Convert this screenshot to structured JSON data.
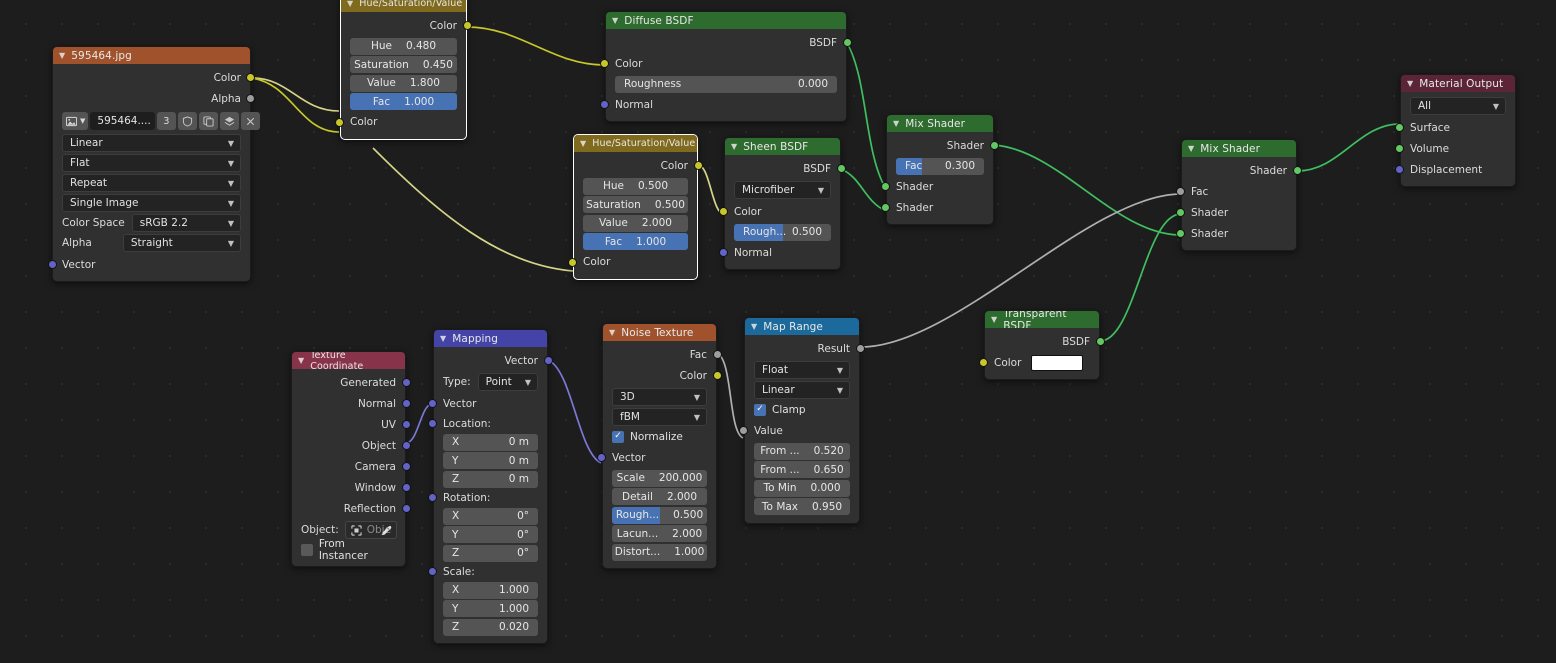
{
  "editor": {
    "name": "Blender Shader Node Editor",
    "background": "#1d1d1d"
  },
  "palette": {
    "input_header": "#a0522d",
    "color_header": "#806a1d",
    "shader_header": "#2e6b2e",
    "output_header": "#5b2537",
    "vector_header": "#4343a8",
    "texture_header": "#a0522d",
    "converter_header": "#1b6a9b",
    "slider_fill": "#4772b3",
    "socket_color": "#c7c729",
    "socket_shader": "#63c763",
    "socket_vector": "#6363c7",
    "socket_float": "#9d9d9d",
    "wire_color": "#d6d48a",
    "wire_shader": "#3fbf5f",
    "wire_float": "#b0b0b0",
    "wire_vector": "#7a79d4"
  },
  "nodes": {
    "image_texture": {
      "title": "595464.jpg",
      "outputs": [
        {
          "label": "Color"
        },
        {
          "label": "Alpha"
        }
      ],
      "toolbar": {
        "browse_icon": "image-browse-icon",
        "chevron_icon": "chevron-down-icon",
        "name": "595464....",
        "users": "3",
        "fake_user_icon": "shield-icon",
        "copy_icon": "duplicate-icon",
        "pack_icon": "pack-icon",
        "unlink_icon": "close-icon"
      },
      "interpolation": "Linear",
      "projection": "Flat",
      "extension": "Repeat",
      "source": "Single Image",
      "color_space_label": "Color Space",
      "color_space": "sRGB 2.2",
      "alpha_label": "Alpha",
      "alpha": "Straight",
      "inputs": [
        {
          "label": "Vector"
        }
      ]
    },
    "hsv_top": {
      "title": "Hue/Saturation/Value",
      "outputs": [
        {
          "label": "Color"
        }
      ],
      "fields": [
        {
          "name": "Hue",
          "value": "0.480"
        },
        {
          "name": "Saturation",
          "value": "0.450"
        },
        {
          "name": "Value",
          "value": "1.800"
        },
        {
          "name": "Fac",
          "value": "1.000"
        }
      ],
      "inputs": [
        {
          "label": "Color"
        }
      ]
    },
    "hsv_bottom": {
      "title": "Hue/Saturation/Value",
      "outputs": [
        {
          "label": "Color"
        }
      ],
      "fields": [
        {
          "name": "Hue",
          "value": "0.500"
        },
        {
          "name": "Saturation",
          "value": "0.500"
        },
        {
          "name": "Value",
          "value": "2.000"
        },
        {
          "name": "Fac",
          "value": "1.000"
        }
      ],
      "inputs": [
        {
          "label": "Color"
        }
      ]
    },
    "diffuse_bsdf": {
      "title": "Diffuse BSDF",
      "outputs": [
        {
          "label": "BSDF"
        }
      ],
      "color_label": "Color",
      "roughness": {
        "name": "Roughness",
        "value": "0.000"
      },
      "normal_label": "Normal"
    },
    "sheen_bsdf": {
      "title": "Sheen BSDF",
      "outputs": [
        {
          "label": "BSDF"
        }
      ],
      "distribution": "Microfiber",
      "color_label": "Color",
      "roughness": {
        "name": "Rough...",
        "value": "0.500"
      },
      "normal_label": "Normal"
    },
    "mix_shader_1": {
      "title": "Mix Shader",
      "outputs": [
        {
          "label": "Shader"
        }
      ],
      "fac": {
        "name": "Fac",
        "value": "0.300"
      },
      "inputs": [
        {
          "label": "Shader"
        },
        {
          "label": "Shader"
        }
      ]
    },
    "mix_shader_2": {
      "title": "Mix Shader",
      "outputs": [
        {
          "label": "Shader"
        }
      ],
      "inputs": [
        {
          "label": "Fac"
        },
        {
          "label": "Shader"
        },
        {
          "label": "Shader"
        }
      ]
    },
    "material_output": {
      "title": "Material Output",
      "target": "All",
      "inputs": [
        {
          "label": "Surface"
        },
        {
          "label": "Volume"
        },
        {
          "label": "Displacement"
        }
      ]
    },
    "transparent_bsdf": {
      "title": "Transparent BSDF",
      "outputs": [
        {
          "label": "BSDF"
        }
      ],
      "color_label": "Color",
      "color_value": "#ffffff"
    },
    "map_range": {
      "title": "Map Range",
      "outputs": [
        {
          "label": "Result"
        }
      ],
      "data_type": "Float",
      "interpolation": "Linear",
      "clamp_label": "Clamp",
      "clamp_checked": true,
      "value_label": "Value",
      "fields": [
        {
          "name": "From ...",
          "value": "0.520"
        },
        {
          "name": "From ...",
          "value": "0.650"
        },
        {
          "name": "To Min",
          "value": "0.000"
        },
        {
          "name": "To Max",
          "value": "0.950"
        }
      ]
    },
    "noise_texture": {
      "title": "Noise Texture",
      "outputs": [
        {
          "label": "Fac"
        },
        {
          "label": "Color"
        }
      ],
      "dimensions": "3D",
      "noise_type": "fBM",
      "normalize_label": "Normalize",
      "normalize_checked": true,
      "vector_label": "Vector",
      "fields": [
        {
          "name": "Scale",
          "value": "200.000"
        },
        {
          "name": "Detail",
          "value": "2.000"
        },
        {
          "name": "Rough...",
          "value": "0.500"
        },
        {
          "name": "Lacun...",
          "value": "2.000"
        },
        {
          "name": "Distort...",
          "value": "1.000"
        }
      ]
    },
    "mapping": {
      "title": "Mapping",
      "outputs": [
        {
          "label": "Vector"
        }
      ],
      "type_label": "Type:",
      "type_value": "Point",
      "vector_label": "Vector",
      "location_label": "Location:",
      "location": [
        {
          "axis": "X",
          "value": "0 m"
        },
        {
          "axis": "Y",
          "value": "0 m"
        },
        {
          "axis": "Z",
          "value": "0 m"
        }
      ],
      "rotation_label": "Rotation:",
      "rotation": [
        {
          "axis": "X",
          "value": "0°"
        },
        {
          "axis": "Y",
          "value": "0°"
        },
        {
          "axis": "Z",
          "value": "0°"
        }
      ],
      "scale_label": "Scale:",
      "scale": [
        {
          "axis": "X",
          "value": "1.000"
        },
        {
          "axis": "Y",
          "value": "1.000"
        },
        {
          "axis": "Z",
          "value": "0.020"
        }
      ]
    },
    "texture_coordinate": {
      "title": "Texture Coordinate",
      "outputs": [
        {
          "label": "Generated"
        },
        {
          "label": "Normal"
        },
        {
          "label": "UV"
        },
        {
          "label": "Object"
        },
        {
          "label": "Camera"
        },
        {
          "label": "Window"
        },
        {
          "label": "Reflection"
        }
      ],
      "object_label": "Object:",
      "object_placeholder": "Obje",
      "object_icon": "object-icon",
      "eyedropper_icon": "eyedropper-icon",
      "from_instancer_label": "From Instancer",
      "from_instancer_checked": false
    }
  }
}
